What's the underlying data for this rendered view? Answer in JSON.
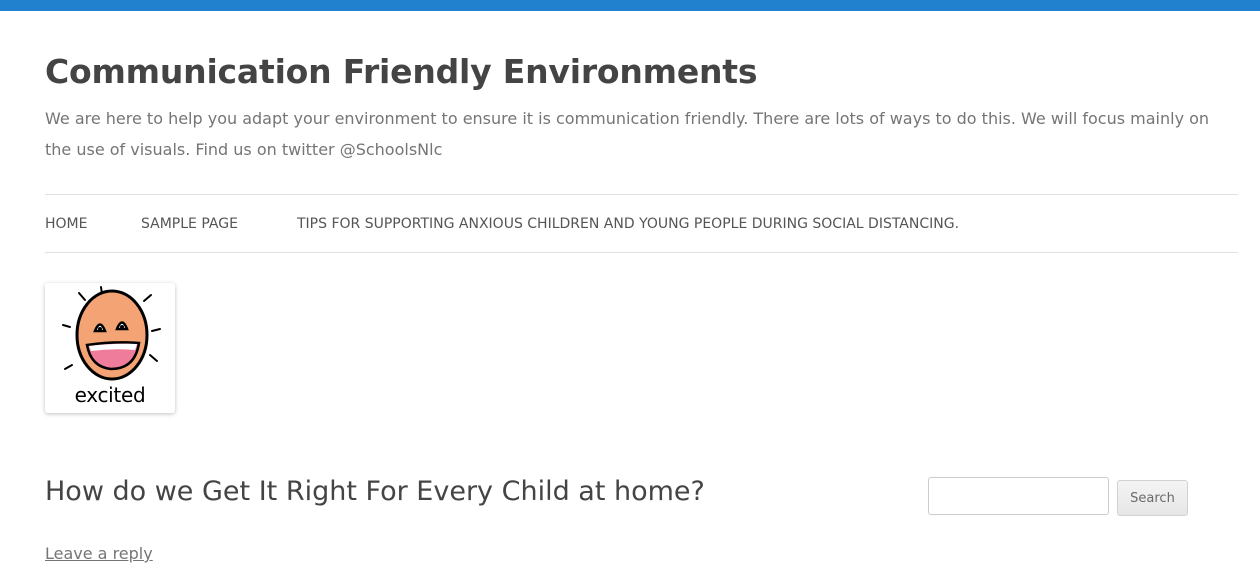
{
  "colors": {
    "top_bar": "#2181cf",
    "text": "#444444",
    "muted_text": "#757575",
    "face_fill": "#f4a374",
    "mouth_fill": "#ee7c9a"
  },
  "site": {
    "title": "Communication Friendly Environments",
    "description": "We are here to help you adapt your environment to ensure it is communication friendly. There are lots of ways to do this. We will focus mainly on the use of visuals. Find us on twitter @SchoolsNlc"
  },
  "nav": {
    "items": [
      {
        "label": "Home"
      },
      {
        "label": "Sample Page"
      },
      {
        "label": "Tips for supporting anxious children and young people during social distancing."
      }
    ]
  },
  "header_image": {
    "icon": "excited-face-icon",
    "caption": "excited"
  },
  "post": {
    "title": "How do we Get It Right For Every Child at home?",
    "reply_link": "Leave a reply"
  },
  "search": {
    "value": "",
    "placeholder": "",
    "button_label": "Search"
  }
}
